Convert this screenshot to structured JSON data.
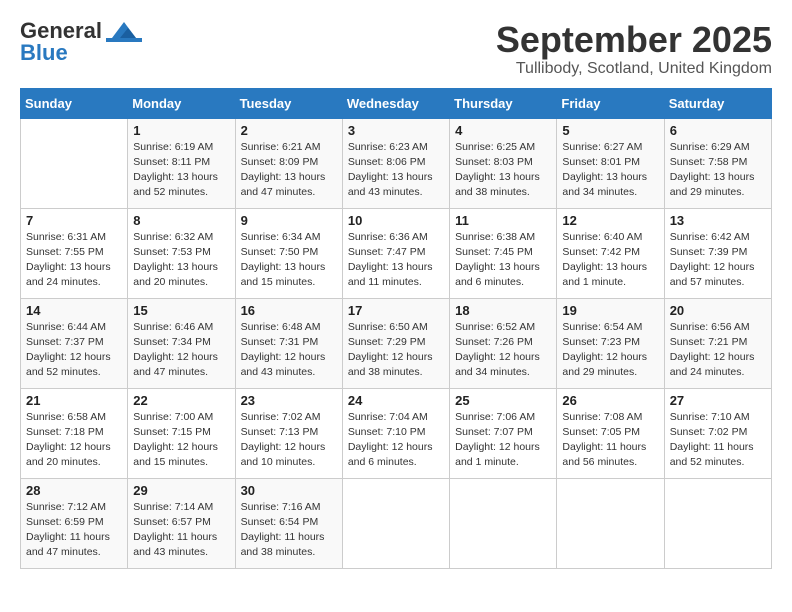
{
  "header": {
    "logo_general": "General",
    "logo_blue": "Blue",
    "month": "September 2025",
    "location": "Tullibody, Scotland, United Kingdom"
  },
  "days_of_week": [
    "Sunday",
    "Monday",
    "Tuesday",
    "Wednesday",
    "Thursday",
    "Friday",
    "Saturday"
  ],
  "weeks": [
    [
      {
        "day": "",
        "info": ""
      },
      {
        "day": "1",
        "info": "Sunrise: 6:19 AM\nSunset: 8:11 PM\nDaylight: 13 hours and 52 minutes."
      },
      {
        "day": "2",
        "info": "Sunrise: 6:21 AM\nSunset: 8:09 PM\nDaylight: 13 hours and 47 minutes."
      },
      {
        "day": "3",
        "info": "Sunrise: 6:23 AM\nSunset: 8:06 PM\nDaylight: 13 hours and 43 minutes."
      },
      {
        "day": "4",
        "info": "Sunrise: 6:25 AM\nSunset: 8:03 PM\nDaylight: 13 hours and 38 minutes."
      },
      {
        "day": "5",
        "info": "Sunrise: 6:27 AM\nSunset: 8:01 PM\nDaylight: 13 hours and 34 minutes."
      },
      {
        "day": "6",
        "info": "Sunrise: 6:29 AM\nSunset: 7:58 PM\nDaylight: 13 hours and 29 minutes."
      }
    ],
    [
      {
        "day": "7",
        "info": "Sunrise: 6:31 AM\nSunset: 7:55 PM\nDaylight: 13 hours and 24 minutes."
      },
      {
        "day": "8",
        "info": "Sunrise: 6:32 AM\nSunset: 7:53 PM\nDaylight: 13 hours and 20 minutes."
      },
      {
        "day": "9",
        "info": "Sunrise: 6:34 AM\nSunset: 7:50 PM\nDaylight: 13 hours and 15 minutes."
      },
      {
        "day": "10",
        "info": "Sunrise: 6:36 AM\nSunset: 7:47 PM\nDaylight: 13 hours and 11 minutes."
      },
      {
        "day": "11",
        "info": "Sunrise: 6:38 AM\nSunset: 7:45 PM\nDaylight: 13 hours and 6 minutes."
      },
      {
        "day": "12",
        "info": "Sunrise: 6:40 AM\nSunset: 7:42 PM\nDaylight: 13 hours and 1 minute."
      },
      {
        "day": "13",
        "info": "Sunrise: 6:42 AM\nSunset: 7:39 PM\nDaylight: 12 hours and 57 minutes."
      }
    ],
    [
      {
        "day": "14",
        "info": "Sunrise: 6:44 AM\nSunset: 7:37 PM\nDaylight: 12 hours and 52 minutes."
      },
      {
        "day": "15",
        "info": "Sunrise: 6:46 AM\nSunset: 7:34 PM\nDaylight: 12 hours and 47 minutes."
      },
      {
        "day": "16",
        "info": "Sunrise: 6:48 AM\nSunset: 7:31 PM\nDaylight: 12 hours and 43 minutes."
      },
      {
        "day": "17",
        "info": "Sunrise: 6:50 AM\nSunset: 7:29 PM\nDaylight: 12 hours and 38 minutes."
      },
      {
        "day": "18",
        "info": "Sunrise: 6:52 AM\nSunset: 7:26 PM\nDaylight: 12 hours and 34 minutes."
      },
      {
        "day": "19",
        "info": "Sunrise: 6:54 AM\nSunset: 7:23 PM\nDaylight: 12 hours and 29 minutes."
      },
      {
        "day": "20",
        "info": "Sunrise: 6:56 AM\nSunset: 7:21 PM\nDaylight: 12 hours and 24 minutes."
      }
    ],
    [
      {
        "day": "21",
        "info": "Sunrise: 6:58 AM\nSunset: 7:18 PM\nDaylight: 12 hours and 20 minutes."
      },
      {
        "day": "22",
        "info": "Sunrise: 7:00 AM\nSunset: 7:15 PM\nDaylight: 12 hours and 15 minutes."
      },
      {
        "day": "23",
        "info": "Sunrise: 7:02 AM\nSunset: 7:13 PM\nDaylight: 12 hours and 10 minutes."
      },
      {
        "day": "24",
        "info": "Sunrise: 7:04 AM\nSunset: 7:10 PM\nDaylight: 12 hours and 6 minutes."
      },
      {
        "day": "25",
        "info": "Sunrise: 7:06 AM\nSunset: 7:07 PM\nDaylight: 12 hours and 1 minute."
      },
      {
        "day": "26",
        "info": "Sunrise: 7:08 AM\nSunset: 7:05 PM\nDaylight: 11 hours and 56 minutes."
      },
      {
        "day": "27",
        "info": "Sunrise: 7:10 AM\nSunset: 7:02 PM\nDaylight: 11 hours and 52 minutes."
      }
    ],
    [
      {
        "day": "28",
        "info": "Sunrise: 7:12 AM\nSunset: 6:59 PM\nDaylight: 11 hours and 47 minutes."
      },
      {
        "day": "29",
        "info": "Sunrise: 7:14 AM\nSunset: 6:57 PM\nDaylight: 11 hours and 43 minutes."
      },
      {
        "day": "30",
        "info": "Sunrise: 7:16 AM\nSunset: 6:54 PM\nDaylight: 11 hours and 38 minutes."
      },
      {
        "day": "",
        "info": ""
      },
      {
        "day": "",
        "info": ""
      },
      {
        "day": "",
        "info": ""
      },
      {
        "day": "",
        "info": ""
      }
    ]
  ]
}
